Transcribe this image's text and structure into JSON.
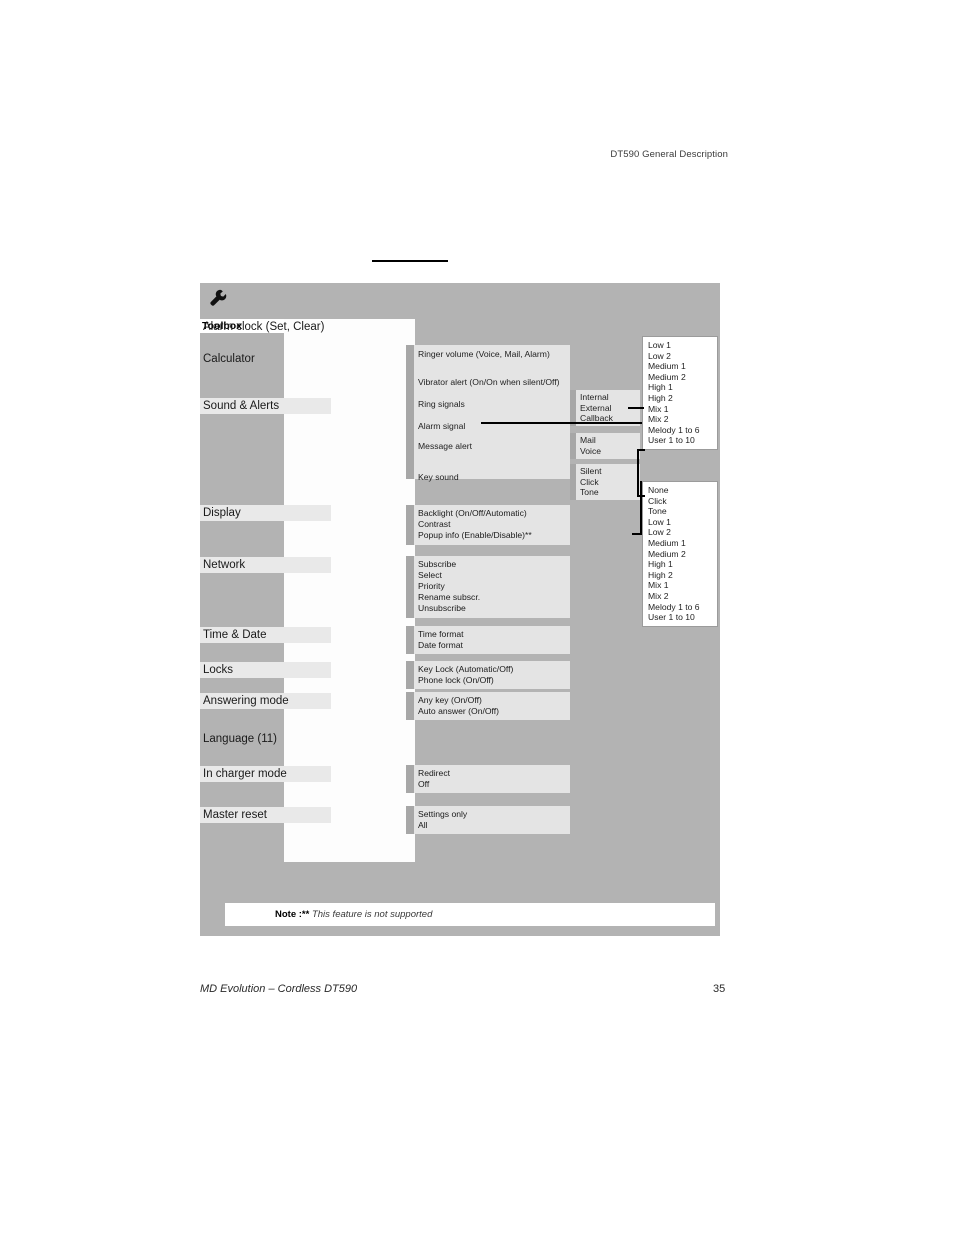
{
  "header": {
    "running_head": "DT590 General Description"
  },
  "figure": {
    "icon": "wrench-icon",
    "root_label": "Toolbox",
    "menu_items": [
      {
        "label": "Alarm clock (Set, Clear)"
      },
      {
        "label": "Calculator"
      },
      {
        "label": "Sound & Alerts"
      },
      {
        "label": "Display"
      },
      {
        "label": "Network"
      },
      {
        "label": "Time & Date"
      },
      {
        "label": "Locks"
      },
      {
        "label": "Answering mode"
      },
      {
        "label": "Language (11)"
      },
      {
        "label": "In charger mode"
      },
      {
        "label": "Master reset"
      }
    ],
    "sound_alerts_subitems": [
      "Ringer volume (Voice, Mail, Alarm)",
      "Vibrator alert (On/On when silent/Off)",
      "Ring signals",
      "Alarm signal",
      "Message alert",
      "Key sound"
    ],
    "display_subitems": [
      "Backlight (On/Off/Automatic)",
      "Contrast",
      "Popup info (Enable/Disable)**"
    ],
    "network_subitems": [
      "Subscribe",
      "Select",
      "Priority",
      "Rename subscr.",
      "Unsubscribe"
    ],
    "time_date_subitems": [
      "Time format",
      "Date format"
    ],
    "locks_subitems": [
      "Key Lock (Automatic/Off)",
      "Phone lock (On/Off)"
    ],
    "answering_subitems": [
      "Any key (On/Off)",
      "Auto answer (On/Off)"
    ],
    "charger_subitems": [
      "Redirect",
      "Off"
    ],
    "master_reset_subitems": [
      "Settings only",
      "All"
    ],
    "ring_signals_options": [
      "Internal",
      "External",
      "Callback"
    ],
    "message_alert_options": [
      "Mail",
      "Voice"
    ],
    "key_sound_options": [
      "Silent",
      "Click",
      "Tone"
    ],
    "melody_list_1": [
      "Low 1",
      "Low 2",
      "Medium 1",
      "Medium 2",
      "High 1",
      "High 2",
      "Mix 1",
      "Mix 2",
      "Melody 1 to 6",
      "User 1 to 10"
    ],
    "melody_list_2": [
      "None",
      "Click",
      "Tone",
      "Low 1",
      "Low 2",
      "Medium 1",
      "Medium 2",
      "High 1",
      "High 2",
      "Mix 1",
      "Mix 2",
      "Melody 1 to 6",
      "User 1 to 10"
    ],
    "note": {
      "label": "Note :",
      "marker": "**",
      "text": "This feature is not supported"
    }
  },
  "footer": {
    "left": "MD Evolution – Cordless DT590",
    "page_number": "35"
  },
  "colors": {
    "panel": "#b3b3b3",
    "sub_block": "#e4e4e4",
    "band": "#e9e9e9",
    "white": "#ffffff"
  }
}
